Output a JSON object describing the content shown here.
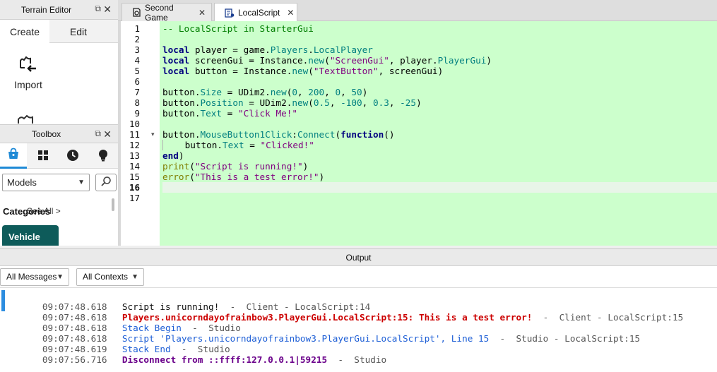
{
  "terrain_editor": {
    "title": "Terrain Editor",
    "undock_glyph": "⧉",
    "close_glyph": "✕",
    "tabs": [
      {
        "label": "Create"
      },
      {
        "label": "Edit"
      }
    ],
    "tools": [
      {
        "label": "Import",
        "icon": "import-terrain-icon"
      }
    ]
  },
  "toolbox": {
    "title": "Toolbox",
    "undock_glyph": "⧉",
    "close_glyph": "✕",
    "tabs": [
      {
        "icon": "marketplace-bag-icon"
      },
      {
        "icon": "inventory-grid-icon"
      },
      {
        "icon": "recent-clock-icon"
      },
      {
        "icon": "creations-bulb-icon"
      }
    ],
    "category_select": "Models",
    "categories_heading": "Categories",
    "see_all": "See All >",
    "featured_category": "Vehicle",
    "accent_color": "#1f8ad6",
    "card_color": "#0e5b5a"
  },
  "editor_tabs": [
    {
      "label": "Second Game",
      "icon": "game-place-icon",
      "close": "✕"
    },
    {
      "label": "LocalScript",
      "icon": "local-script-icon",
      "close": "✕"
    }
  ],
  "editor": {
    "background_color": "#ccffcc",
    "line_numbers": [
      "1",
      "2",
      "3",
      "4",
      "5",
      "6",
      "7",
      "8",
      "9",
      "10",
      "11",
      "12",
      "13",
      "14",
      "15",
      "16",
      "17"
    ],
    "current_line": "16",
    "fold_marker": "▾",
    "code_lines": [
      "-- LocalScript in StarterGui",
      "",
      "local player = game.Players.LocalPlayer",
      "local screenGui = Instance.new(\"ScreenGui\", player.PlayerGui)",
      "local button = Instance.new(\"TextButton\", screenGui)",
      "",
      "button.Size = UDim2.new(0, 200, 0, 50)",
      "button.Position = UDim2.new(0.5, -100, 0.3, -25)",
      "button.Text = \"Click Me!\"",
      "",
      "button.MouseButton1Click:Connect(function()",
      "    button.Text = \"Clicked!\"",
      "end)",
      "print(\"Script is running!\")",
      "error(\"This is a test error!\")",
      "",
      ""
    ]
  },
  "output": {
    "title": "Output",
    "message_filter": "All Messages",
    "context_filter": "All Contexts",
    "entries": [
      {
        "time": "09:07:48.618",
        "text": "Script is running!",
        "meta": "  -  Client - LocalScript:14",
        "kind": "normal"
      },
      {
        "time": "09:07:48.618",
        "text": "Players.unicorndayofrainbow3.PlayerGui.LocalScript:15: This is a test error!",
        "meta": "  -  Client - LocalScript:15",
        "kind": "error"
      },
      {
        "time": "09:07:48.618",
        "text": "Stack Begin",
        "meta": "  -  Studio",
        "kind": "info"
      },
      {
        "time": "09:07:48.618",
        "text": "Script 'Players.unicorndayofrainbow3.PlayerGui.LocalScript', Line 15",
        "meta": "  -  Studio - LocalScript:15",
        "kind": "info"
      },
      {
        "time": "09:07:48.619",
        "text": "Stack End",
        "meta": "  -  Studio",
        "kind": "info"
      },
      {
        "time": "09:07:56.716",
        "text": "Disconnect from ::ffff:127.0.0.1|59215",
        "meta": "  -  Studio",
        "kind": "disconnect"
      }
    ]
  }
}
